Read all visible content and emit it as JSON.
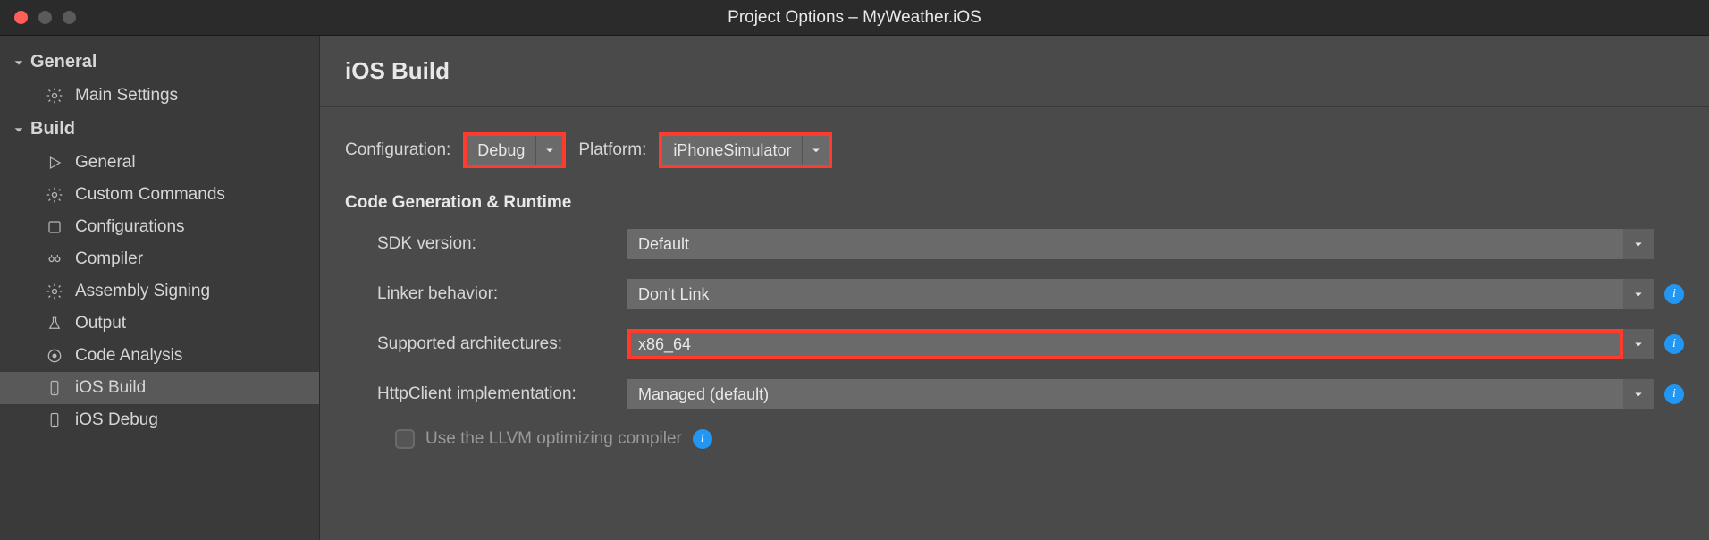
{
  "window": {
    "title": "Project Options – MyWeather.iOS"
  },
  "sidebar": {
    "categories": [
      {
        "label": "General",
        "items": [
          {
            "icon": "gear-icon",
            "label": "Main Settings"
          }
        ]
      },
      {
        "label": "Build",
        "items": [
          {
            "icon": "play-icon",
            "label": "General"
          },
          {
            "icon": "gear-icon",
            "label": "Custom Commands"
          },
          {
            "icon": "square-icon",
            "label": "Configurations"
          },
          {
            "icon": "robot-icon",
            "label": "Compiler"
          },
          {
            "icon": "gear-icon",
            "label": "Assembly Signing"
          },
          {
            "icon": "flask-icon",
            "label": "Output"
          },
          {
            "icon": "target-icon",
            "label": "Code Analysis"
          },
          {
            "icon": "phone-icon",
            "label": "iOS Build",
            "selected": true
          },
          {
            "icon": "phone-icon",
            "label": "iOS Debug"
          }
        ]
      }
    ]
  },
  "main": {
    "title": "iOS Build",
    "config": {
      "configuration_label": "Configuration:",
      "configuration_value": "Debug",
      "platform_label": "Platform:",
      "platform_value": "iPhoneSimulator"
    },
    "section_heading": "Code Generation & Runtime",
    "rows": {
      "sdk_label": "SDK version:",
      "sdk_value": "Default",
      "linker_label": "Linker behavior:",
      "linker_value": "Don't Link",
      "arch_label": "Supported architectures:",
      "arch_value": "x86_64",
      "http_label": "HttpClient implementation:",
      "http_value": "Managed (default)"
    },
    "llvm_checkbox": "Use the LLVM optimizing compiler"
  }
}
